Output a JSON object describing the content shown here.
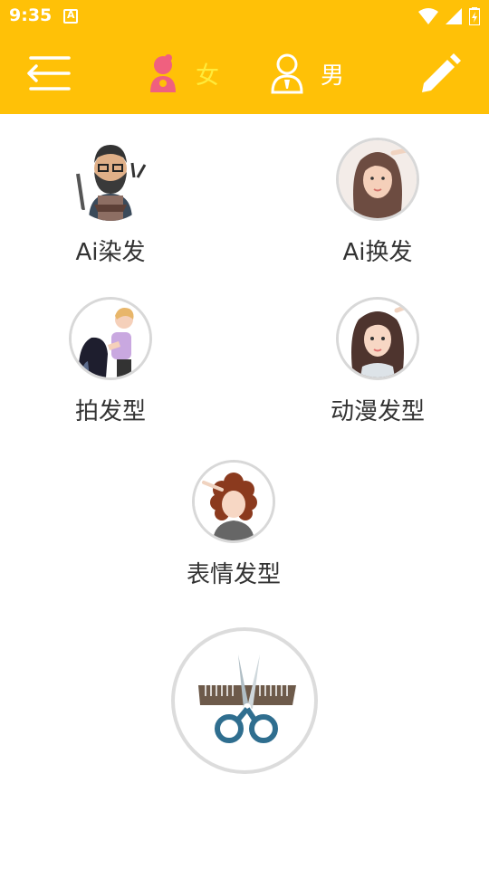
{
  "status_bar": {
    "time": "9:35",
    "icons": [
      "notification-icon",
      "wifi-icon",
      "signal-icon",
      "battery-icon"
    ]
  },
  "app_bar": {
    "menu_icon": "back-menu-icon",
    "tabs": [
      {
        "label": "女",
        "icon": "female-icon",
        "selected": true
      },
      {
        "label": "男",
        "icon": "male-icon",
        "selected": false
      }
    ],
    "edit_icon": "pencil-icon"
  },
  "features": [
    {
      "label": "Ai染发",
      "icon": "barber-avatar-icon"
    },
    {
      "label": "Ai换发",
      "icon": "woman-portrait-icon"
    },
    {
      "label": "拍发型",
      "icon": "hairdresser-scene-icon"
    },
    {
      "label": "动漫发型",
      "icon": "anime-woman-icon"
    },
    {
      "label": "表情发型",
      "icon": "curly-hair-icon"
    }
  ],
  "action_button": {
    "icon": "scissors-comb-icon"
  },
  "colors": {
    "accent": "#FFC107",
    "selected_tab": "#FFEB3B",
    "text": "#333333"
  }
}
